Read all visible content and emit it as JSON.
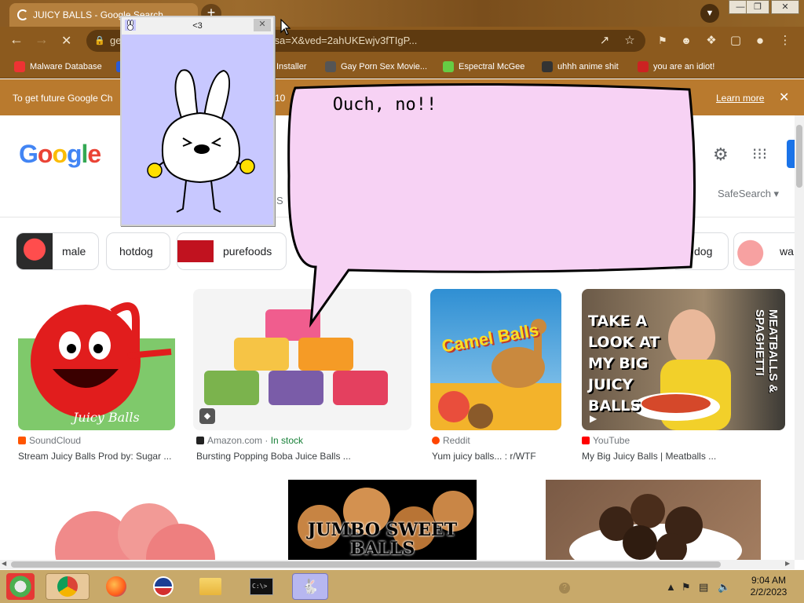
{
  "browser": {
    "tab_title": "JUICY BALLS - Google Search",
    "new_tab_label": "+",
    "url": "ge...ALLS&source=lnms&tbm=isch&sa=X&ved=2ahUKEwjv3fTIgP...",
    "bookmarks": [
      {
        "label": "Malware Database",
        "color": "#e33"
      },
      {
        "label": "Installer",
        "color": "#2a5bd7"
      },
      {
        "label": "Gay Porn Sex Movie...",
        "color": "#555"
      },
      {
        "label": "Espectral McGee",
        "color": "#6c4"
      },
      {
        "label": "uhhh anime shit",
        "color": "#333"
      },
      {
        "label": "you are an idiot!",
        "color": "#c22"
      }
    ],
    "infobar_message": "To get future Google Ch",
    "infobar_message_tail": "10",
    "infobar_learn_more": "Learn more"
  },
  "google": {
    "logo_letters": [
      "G",
      "o",
      "o",
      "g",
      "l",
      "e"
    ],
    "safesearch_label": "SafeSearch ▾",
    "search_hint": "S",
    "chips": [
      {
        "label": "male",
        "color": "#d62828"
      },
      {
        "label": "hotdog",
        "color": ""
      },
      {
        "label": "purefoods",
        "color": "#c1121f"
      },
      {
        "label": "dog",
        "color": ""
      },
      {
        "label": "wa",
        "color": "#f28482"
      }
    ],
    "results": [
      {
        "source": "SoundCloud",
        "title": "Stream Juicy Balls Prod by: Sugar ...",
        "fav_color": "#ff5500",
        "img_text": "Juicy Balls"
      },
      {
        "source": "Amazon.com",
        "extra": "In stock",
        "title": "Bursting Popping Boba Juice Balls ...",
        "fav_color": "#222"
      },
      {
        "source": "Reddit",
        "title": "Yum juicy balls... : r/WTF",
        "fav_color": "#ff4500",
        "img_text": "Camel Balls"
      },
      {
        "source": "YouTube",
        "title": "My Big Juicy Balls | Meatballs ...",
        "fav_color": "#ff0000",
        "img_text": [
          "TAKE A",
          "LOOK AT",
          "MY BIG",
          "JUICY",
          "BALLS"
        ],
        "side_text": "MEATBALLS & SPAGHETTI"
      }
    ],
    "row2_text": [
      "JUMBO SWEET",
      "BALLS"
    ]
  },
  "popup": {
    "title": "<3",
    "close_label": "✕",
    "bubble_text": "Ouch, no!!"
  },
  "taskbar": {
    "time": "9:04 AM",
    "date": "2/2/2023"
  }
}
